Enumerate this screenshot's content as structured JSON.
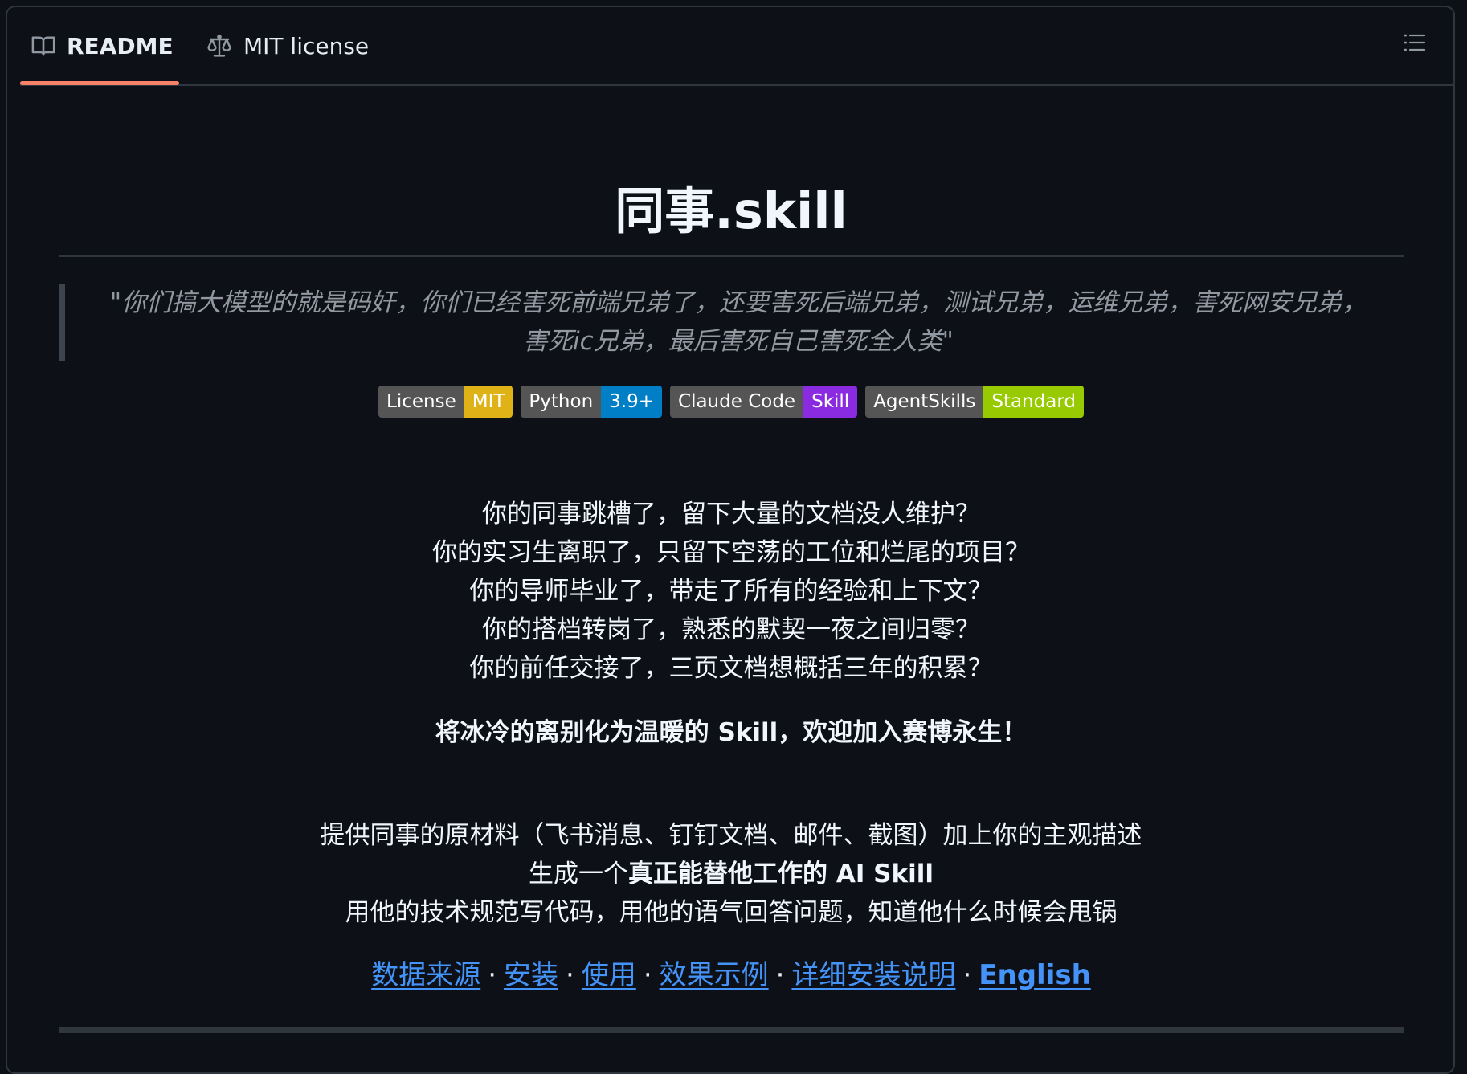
{
  "tabs": {
    "readme_label": "README",
    "license_label": "MIT license"
  },
  "icons": {
    "readme": "book-icon",
    "license": "scale-icon",
    "toc": "list-icon"
  },
  "colors": {
    "background": "#0d1117",
    "border": "#30363d",
    "active_tab": "#f78166",
    "link": "#4493f8"
  },
  "title": "同事.skill",
  "quote": "\"你们搞大模型的就是码奸，你们已经害死前端兄弟了，还要害死后端兄弟，测试兄弟，运维兄弟，害死网安兄弟，害死ic兄弟，最后害死自己害死全人类\"",
  "badges": [
    {
      "label": "License",
      "value": "MIT",
      "color": "#dfb317"
    },
    {
      "label": "Python",
      "value": "3.9+",
      "color": "#007ec6"
    },
    {
      "label": "Claude Code",
      "value": "Skill",
      "color": "#8a2be2"
    },
    {
      "label": "AgentSkills",
      "value": "Standard",
      "color": "#97ca00"
    }
  ],
  "intro_lines": [
    "你的同事跳槽了，留下大量的文档没人维护？",
    "你的实习生离职了，只留下空荡的工位和烂尾的项目？",
    "你的导师毕业了，带走了所有的经验和上下文？",
    "你的搭档转岗了，熟悉的默契一夜之间归零？",
    "你的前任交接了，三页文档想概括三年的积累？"
  ],
  "tagline": "将冰冷的离别化为温暖的 Skill，欢迎加入赛博永生！",
  "desc": {
    "line1": "提供同事的原材料（飞书消息、钉钉文档、邮件、截图）加上你的主观描述",
    "line2_prefix": "生成一个",
    "line2_bold": "真正能替他工作的 AI Skill",
    "line3": "用他的技术规范写代码，用他的语气回答问题，知道他什么时候会甩锅"
  },
  "nav_links": [
    "数据来源",
    "安装",
    "使用",
    "效果示例",
    "详细安装说明",
    "English"
  ],
  "nav_separator": "·"
}
